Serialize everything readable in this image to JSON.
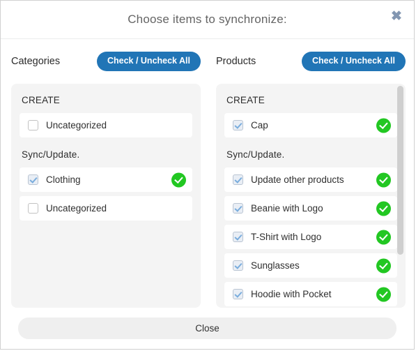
{
  "dialog": {
    "title": "Choose items to synchronize:",
    "close_icon": "close-icon",
    "close_icon_glyph": "✖"
  },
  "colors": {
    "primary_blue": "#2175b6",
    "success_green": "#22c722",
    "panel_bg": "#f4f4f4",
    "footer_button_bg": "#efefef",
    "close_x": "#8296b1"
  },
  "columns": [
    {
      "id": "categories",
      "title": "Categories",
      "check_all_label": "Check / Uncheck All",
      "sections": [
        {
          "label": "CREATE",
          "items": [
            {
              "label": "Uncategorized",
              "checked": false,
              "synced": false
            }
          ]
        },
        {
          "label": "Sync/Update.",
          "items": [
            {
              "label": "Clothing",
              "checked": true,
              "synced": true
            },
            {
              "label": "Uncategorized",
              "checked": false,
              "synced": false
            }
          ]
        }
      ]
    },
    {
      "id": "products",
      "title": "Products",
      "check_all_label": "Check / Uncheck All",
      "scrollable": true,
      "sections": [
        {
          "label": "CREATE",
          "items": [
            {
              "label": "Cap",
              "checked": true,
              "synced": true
            }
          ]
        },
        {
          "label": "Sync/Update.",
          "items": [
            {
              "label": "Update other products",
              "checked": true,
              "synced": true
            },
            {
              "label": "Beanie with Logo",
              "checked": true,
              "synced": true
            },
            {
              "label": "T-Shirt with Logo",
              "checked": true,
              "synced": true
            },
            {
              "label": "Sunglasses",
              "checked": true,
              "synced": true
            },
            {
              "label": "Hoodie with Pocket",
              "checked": true,
              "synced": true
            }
          ]
        }
      ]
    }
  ],
  "footer": {
    "close_label": "Close"
  }
}
